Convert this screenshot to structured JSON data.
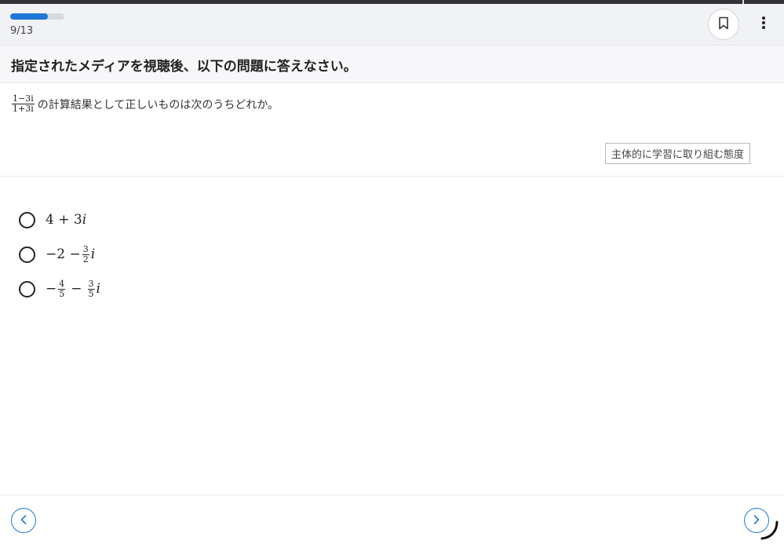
{
  "progress": {
    "current": 9,
    "total": 13,
    "label": "9/13",
    "fraction": 0.69
  },
  "icons": {
    "bookmark": "bookmark-icon",
    "more": "more-vertical-icon",
    "prev": "chevron-left-icon",
    "next": "chevron-right-icon"
  },
  "colors": {
    "accent": "#1f78d8",
    "header_bg": "#f1f2f5"
  },
  "instruction": "指定されたメディアを視聴後、以下の問題に答えなさい。",
  "question": {
    "fraction_numerator": "1−3i",
    "fraction_denominator": "1+3i",
    "text": "の計算結果として正しいものは次のうちどれか。",
    "tag": "主体的に学習に取り組む態度"
  },
  "options": [
    {
      "a": "4 + 3",
      "i": "i"
    },
    {
      "a": "−2 −",
      "num": "3",
      "den": "2",
      "i": "i"
    },
    {
      "a": "−",
      "num1": "4",
      "den1": "5",
      "mid": "−",
      "num2": "3",
      "den2": "5",
      "i": "i"
    }
  ]
}
